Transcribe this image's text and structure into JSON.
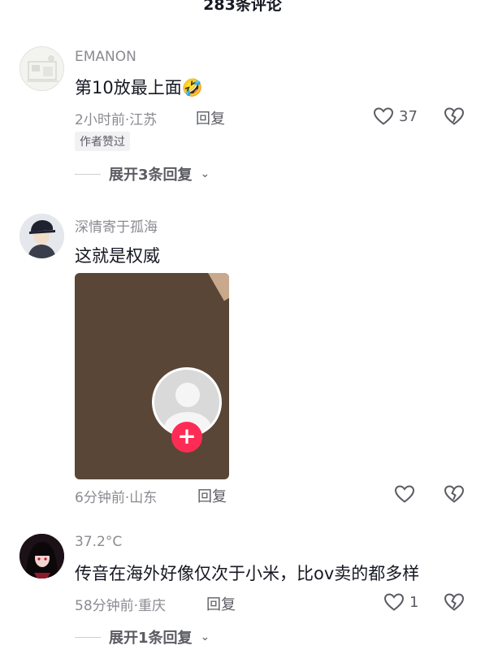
{
  "header": {
    "title": "283条评论"
  },
  "comments": [
    {
      "username": "EMANON",
      "text": "第10放最上面",
      "emoji": "🤣",
      "meta": "2小时前·江苏",
      "reply_label": "回复",
      "likes": "37",
      "badge": "作者赞过",
      "expand_label": "展开3条回复"
    },
    {
      "username": "深情寄于孤海",
      "text": "这就是权威",
      "meta": "6分钟前·山东",
      "reply_label": "回复",
      "likes": ""
    },
    {
      "username": "37.2°C",
      "text": "传音在海外好像仅次于小米，比ov卖的都多样",
      "meta": "58分钟前·重庆",
      "reply_label": "回复",
      "likes": "1",
      "expand_label": "展开1条回复"
    }
  ],
  "icons": {
    "like": "heart-outline-icon",
    "dislike": "broken-heart-icon",
    "chevron": "chevron-down-icon",
    "follow": "plus-icon"
  },
  "colors": {
    "accent": "#fe2c55",
    "secondary_text": "#8a8b91"
  }
}
